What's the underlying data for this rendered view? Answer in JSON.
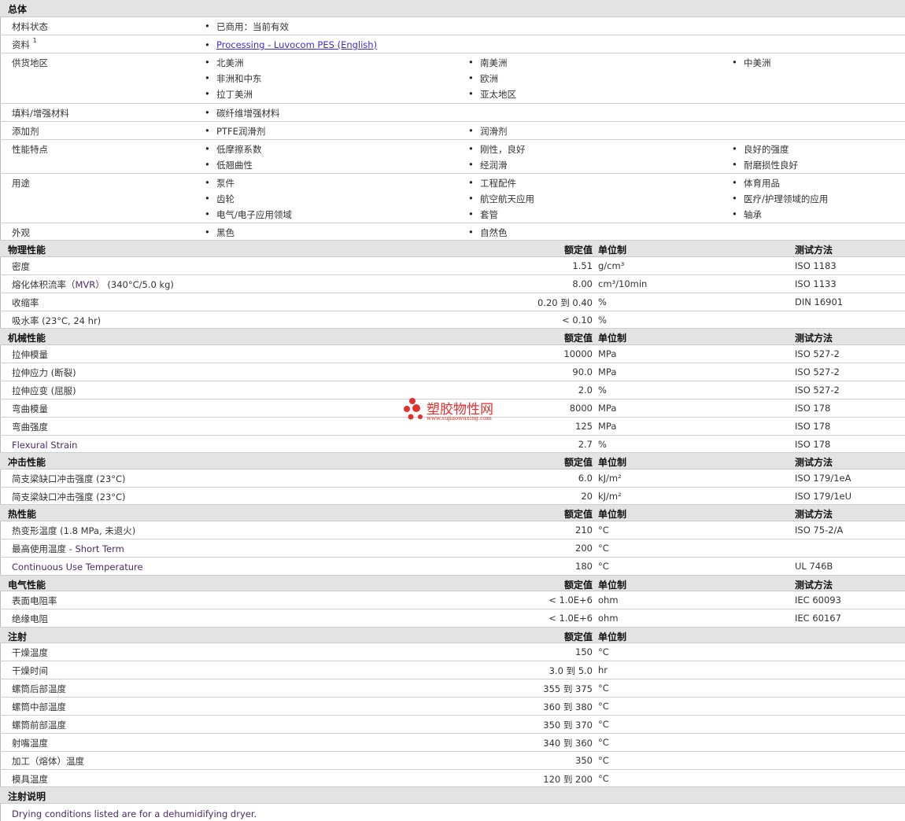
{
  "general": {
    "title": "总体",
    "status_label": "材料状态",
    "status_value": "已商用：当前有效",
    "docs_label": "资料",
    "docs_sup": "1",
    "docs_link": "Processing - Luvocom PES (English)",
    "regions_label": "供货地区",
    "regions": [
      "北美洲",
      "南美洲",
      "中美洲",
      "非洲和中东",
      "欧洲",
      "拉丁美洲",
      "亚太地区"
    ],
    "filler_label": "填料/增强材料",
    "filler_value": "碳纤维增强材料",
    "additive_label": "添加剂",
    "additives": [
      "PTFE润滑剂",
      "润滑剂"
    ],
    "features_label": "性能特点",
    "features": [
      "低摩擦系数",
      "刚性，良好",
      "良好的强度",
      "低翘曲性",
      "经润滑",
      "耐磨损性良好"
    ],
    "uses_label": "用途",
    "uses": [
      "泵件",
      "工程配件",
      "体育用品",
      "齿轮",
      "航空航天应用",
      "医疗/护理领域的应用",
      "电气/电子应用领域",
      "套管",
      "轴承"
    ],
    "appearance_label": "外观",
    "appearance": [
      "黑色",
      "自然色"
    ]
  },
  "headers": {
    "nominal": "额定值",
    "unit": "单位制",
    "method": "测试方法"
  },
  "physical": {
    "title": "物理性能",
    "rows": [
      {
        "label": "密度",
        "value": "1.51",
        "unit": "g/cm³",
        "method": "ISO 1183"
      },
      {
        "label": "熔化体积流率（",
        "label_mid": "MVR",
        "label_end": "）  (340°C/5.0 kg)",
        "value": "8.00",
        "unit": "cm³/10min",
        "method": "ISO 1133"
      },
      {
        "label": "收缩率",
        "value": "0.20 到  0.40",
        "unit": "%",
        "method": "DIN 16901"
      },
      {
        "label": "吸水率  (23°C, 24 hr)",
        "value": "< 0.10",
        "unit": "%",
        "method": ""
      }
    ]
  },
  "mechanical": {
    "title": "机械性能",
    "rows": [
      {
        "label": "拉伸模量",
        "value": "10000",
        "unit": "MPa",
        "method": "ISO 527-2"
      },
      {
        "label": "拉伸应力  (断裂)",
        "value": "90.0",
        "unit": "MPa",
        "method": "ISO 527-2"
      },
      {
        "label": "拉伸应变  (屈服)",
        "value": "2.0",
        "unit": "%",
        "method": "ISO 527-2"
      },
      {
        "label": "弯曲模量",
        "value": "8000",
        "unit": "MPa",
        "method": "ISO 178"
      },
      {
        "label": "弯曲强度",
        "value": "125",
        "unit": "MPa",
        "method": "ISO 178"
      },
      {
        "label": "Flexural Strain",
        "value": "2.7",
        "unit": "%",
        "method": "ISO 178"
      }
    ]
  },
  "impact": {
    "title": "冲击性能",
    "rows": [
      {
        "label": "简支梁缺口冲击强度  (23°C)",
        "value": "6.0",
        "unit": "kJ/m²",
        "method": "ISO 179/1eA"
      },
      {
        "label": "简支梁缺口冲击强度  (23°C)",
        "value": "20",
        "unit": "kJ/m²",
        "method": "ISO 179/1eU"
      }
    ]
  },
  "thermal": {
    "title": "热性能",
    "rows": [
      {
        "label": "热变形温度  (1.8 MPa, 未退火)",
        "value": "210",
        "unit": "°C",
        "method": "ISO 75-2/A"
      },
      {
        "label": "最高使用温度",
        "label_end": " - Short Term",
        "value": "200",
        "unit": "°C",
        "method": ""
      },
      {
        "label": "Continuous Use Temperature",
        "value": "180",
        "unit": "°C",
        "method": "UL 746B"
      }
    ]
  },
  "electrical": {
    "title": "电气性能",
    "rows": [
      {
        "label": "表面电阻率",
        "value": "< 1.0E+6",
        "unit": "ohm",
        "method": "IEC 60093"
      },
      {
        "label": "绝缘电阻",
        "value": "< 1.0E+6",
        "unit": "ohm",
        "method": "IEC 60167"
      }
    ]
  },
  "injection": {
    "title": "注射",
    "rows": [
      {
        "label": "干燥温度",
        "value": "150",
        "unit": "°C"
      },
      {
        "label": "干燥时间",
        "value": "3.0 到  5.0",
        "unit": "hr"
      },
      {
        "label": "螺筒后部温度",
        "value": "355 到  375",
        "unit": "°C"
      },
      {
        "label": "螺筒中部温度",
        "value": "360 到  380",
        "unit": "°C"
      },
      {
        "label": "螺筒前部温度",
        "value": "350 到  370",
        "unit": "°C"
      },
      {
        "label": "射嘴温度",
        "value": "340 到  360",
        "unit": "°C"
      },
      {
        "label": "加工（熔体）温度",
        "value": "350",
        "unit": "°C"
      },
      {
        "label": "模具温度",
        "value": "120 到  200",
        "unit": "°C"
      }
    ]
  },
  "notes": {
    "title": "注射说明",
    "text": "Drying conditions listed are for a dehumidifying dryer."
  },
  "watermark": {
    "text": "塑胶物性网",
    "url": "www.sujiaowuxing.com",
    "color": "#e23030"
  }
}
